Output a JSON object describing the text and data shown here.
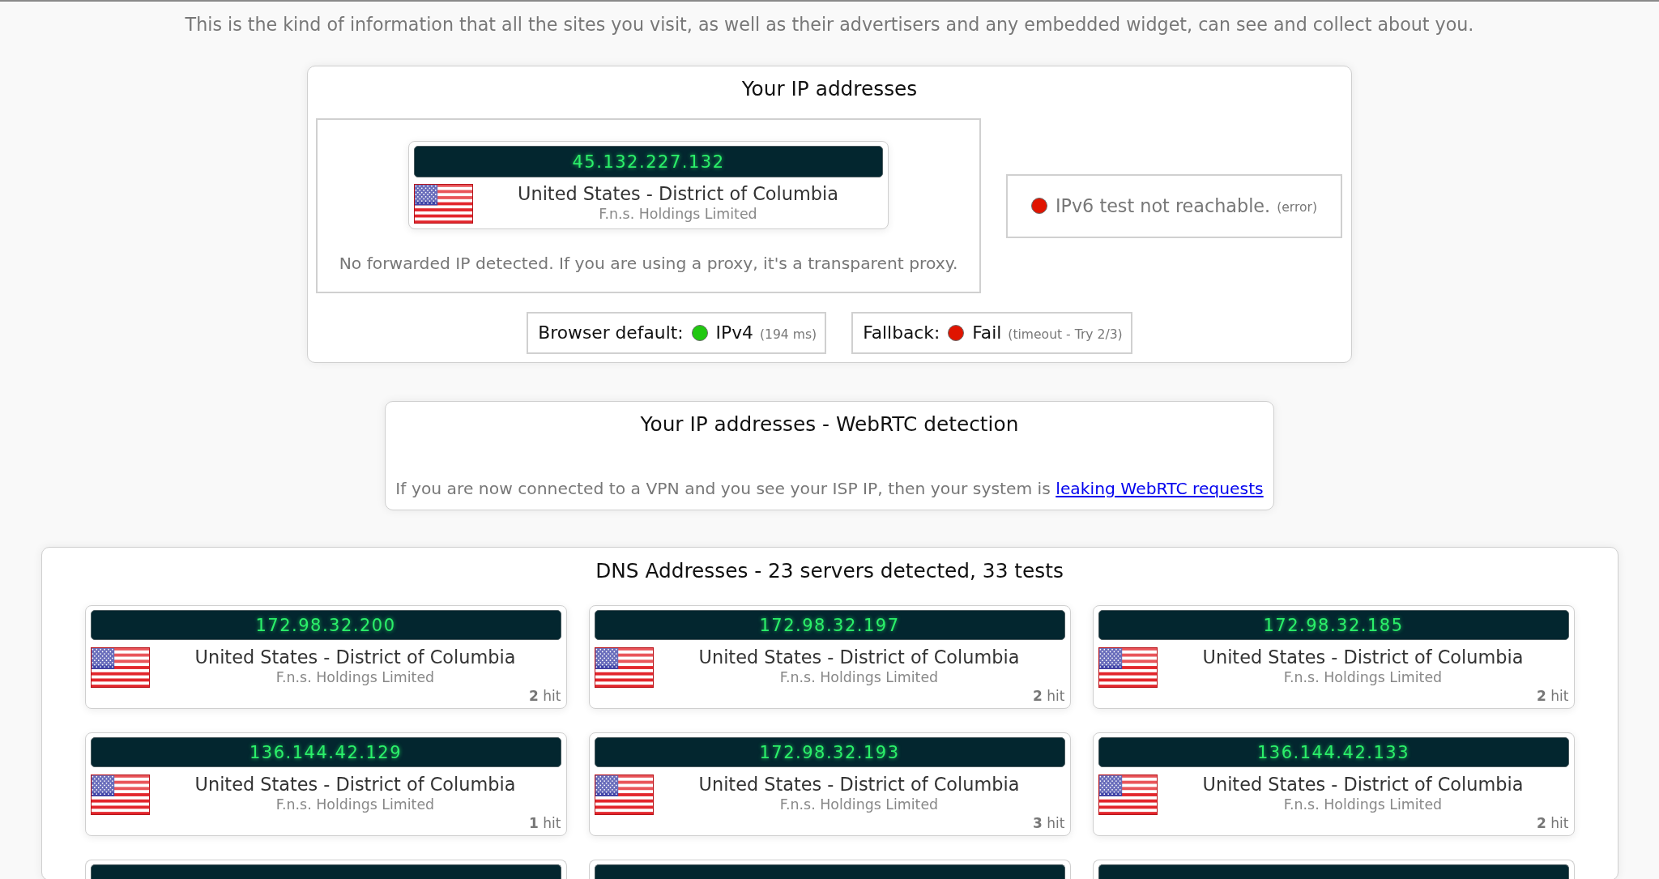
{
  "intro": "This is the kind of information that all the sites you visit, as well as their advertisers and any embedded widget, can see and collect about you.",
  "ip_panel": {
    "title": "Your IP addresses",
    "ipv4": {
      "ip": "45.132.227.132",
      "location": "United States - District of Columbia",
      "isp": "F.n.s. Holdings Limited"
    },
    "forwarded_note": "No forwarded IP detected. If you are using a proxy, it's a transparent proxy.",
    "ipv6": {
      "color": "#e01400",
      "message": "IPv6 test not reachable.",
      "note": "(error)"
    },
    "tests": [
      {
        "label": "Browser default:",
        "color": "#20c810",
        "result": "IPv4",
        "note": "(194 ms)"
      },
      {
        "label": "Fallback:",
        "color": "#e01400",
        "result": "Fail",
        "note": "(timeout - Try 2/3)"
      }
    ]
  },
  "webrtc_panel": {
    "title": "Your IP addresses - WebRTC detection",
    "note": "If you are now connected to a VPN and you see your ISP IP, then your system is",
    "link": "leaking WebRTC requests"
  },
  "dns_panel": {
    "title": "DNS Addresses - 23 servers detected, 33 tests",
    "servers": [
      {
        "kind": "full",
        "ip": "172.98.32.200",
        "location": "United States - District of Columbia",
        "isp": "F.n.s. Holdings Limited",
        "hits": "**2** hit"
      },
      {
        "kind": "full",
        "ip": "172.98.32.197",
        "location": "United States - District of Columbia",
        "isp": "F.n.s. Holdings Limited",
        "hits": "**2** hit"
      },
      {
        "kind": "full",
        "ip": "172.98.32.185",
        "location": "United States - District of Columbia",
        "isp": "F.n.s. Holdings Limited",
        "hits": "**2** hit"
      },
      {
        "kind": "full",
        "ip": "136.144.42.129",
        "location": "United States - District of Columbia",
        "isp": "F.n.s. Holdings Limited",
        "hits": "**1** hit"
      },
      {
        "kind": "full",
        "ip": "172.98.32.193",
        "location": "United States - District of Columbia",
        "isp": "F.n.s. Holdings Limited",
        "hits": "**3** hit"
      },
      {
        "kind": "full",
        "ip": "136.144.42.133",
        "location": "United States - District of Columbia",
        "isp": "F.n.s. Holdings Limited",
        "hits": "**2** hit"
      },
      {
        "kind": "cut_off"
      },
      {
        "kind": "cut_off"
      },
      {
        "kind": "cut_off"
      }
    ]
  }
}
